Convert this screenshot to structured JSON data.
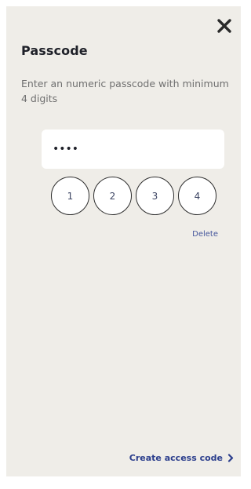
{
  "header": {
    "title": "Passcode",
    "close_icon": "close-icon"
  },
  "instructions": "Enter an numeric passcode with minimum 4 digits",
  "passcode_field": {
    "value": "••••"
  },
  "keypad": {
    "digits": [
      "1",
      "2",
      "3",
      "4"
    ]
  },
  "delete_label": "Delete",
  "footer": {
    "create_label": "Create access code",
    "chevron_icon": "chevron-right-icon"
  },
  "colors": {
    "background": "#efede8",
    "title": "#1f2129",
    "body_text": "#6f6f6f",
    "link": "#46579c",
    "accent": "#2a3d8c"
  }
}
